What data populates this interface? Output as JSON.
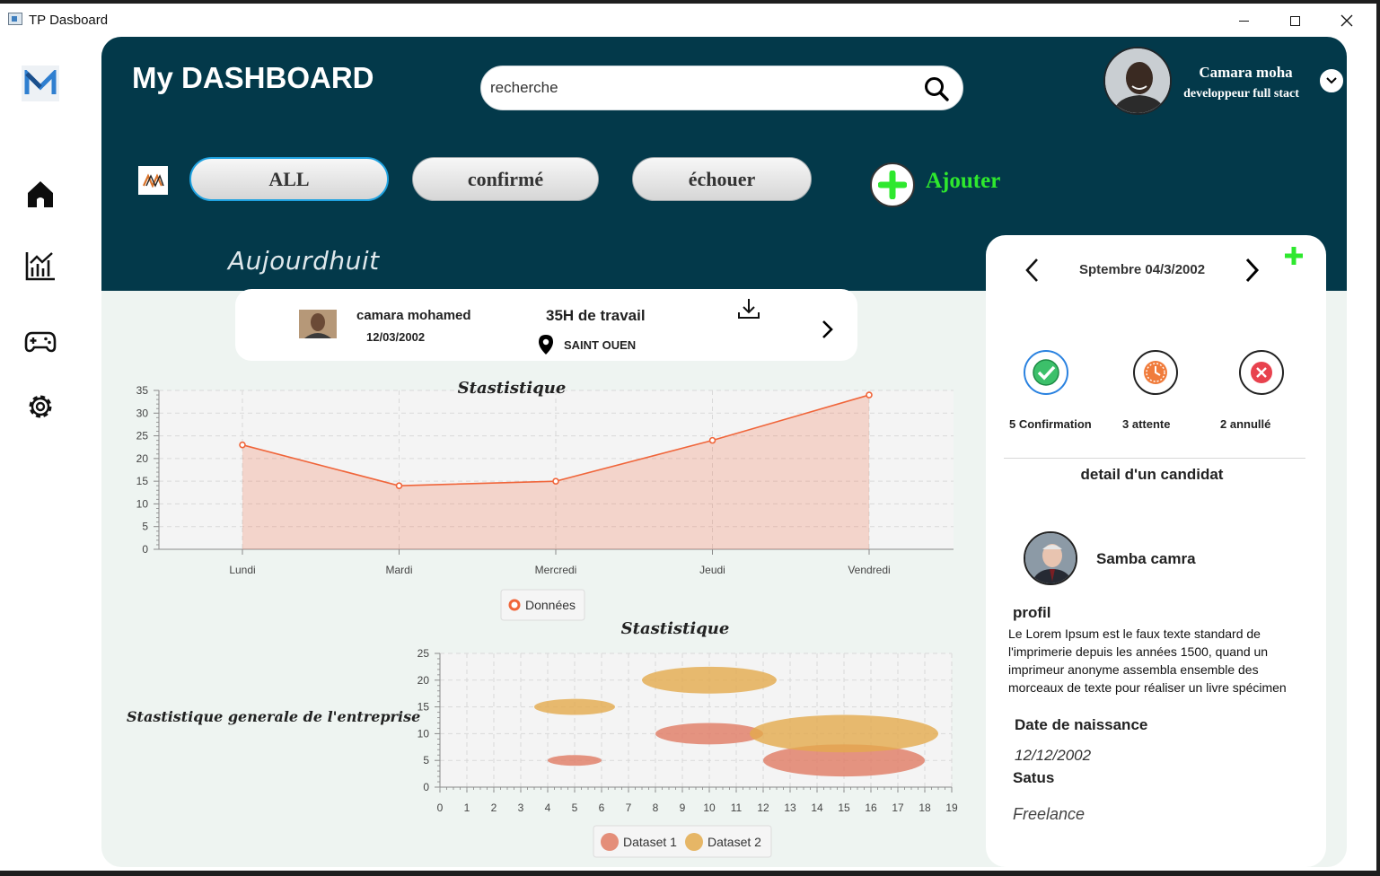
{
  "window": {
    "title": "TP Dasboard"
  },
  "header": {
    "title": "My DASHBOARD",
    "search": {
      "value": "recherche",
      "placeholder": ""
    },
    "user": {
      "name": "Camara moha",
      "role": "developpeur full stact"
    }
  },
  "filters": {
    "all": "ALL",
    "confirmed": "confirmé",
    "failed": "échouer",
    "add": "Ajouter"
  },
  "today_label": "Aujourdhuit",
  "card": {
    "name": "camara mohamed",
    "date": "12/03/2002",
    "hours": "35H de travail",
    "place": "SAINT OUEN"
  },
  "side_panel": {
    "date": "Sptembre 04/3/2002",
    "stats": {
      "confirmed": "5 Confirmation",
      "waiting": "3 attente",
      "cancelled": "2 annullé"
    },
    "detail_title": "detail d'un candidat",
    "candidate": {
      "name": "Samba camra",
      "profil_label": "profil",
      "profil_text": "Le Lorem Ipsum est le faux texte standard de l'imprimerie depuis les années 1500, quand un imprimeur anonyme assembla ensemble des morceaux de texte pour réaliser un livre spécimen",
      "dob_label": "Date de naissance",
      "dob": "12/12/2002",
      "status_label": "Satus",
      "status": "Freelance"
    }
  },
  "side_caption": "Stastistique generale de l'entreprise",
  "colors": {
    "header": "#03394a",
    "accent_green": "#2ee82e",
    "line": "#f0653a",
    "dataset1": "#e07b63",
    "dataset2": "#e3aa4c"
  },
  "chart_data": [
    {
      "type": "area",
      "title": "Stastistique",
      "categories": [
        "Lundi",
        "Mardi",
        "Mercredi",
        "Jeudi",
        "Vendredi"
      ],
      "series": [
        {
          "name": "Données",
          "values": [
            23,
            14,
            15,
            24,
            34
          ]
        }
      ],
      "ylim": [
        0,
        35
      ],
      "yticks": [
        0,
        5,
        10,
        15,
        20,
        25,
        30,
        35
      ],
      "grid": true,
      "legend": "bottom"
    },
    {
      "type": "bubble",
      "title": "Stastistique",
      "xlim": [
        0,
        19
      ],
      "ylim": [
        0,
        25
      ],
      "xticks": [
        0,
        1,
        2,
        3,
        4,
        5,
        6,
        7,
        8,
        9,
        10,
        11,
        12,
        13,
        14,
        15,
        16,
        17,
        18,
        19
      ],
      "yticks": [
        0,
        5,
        10,
        15,
        20,
        25
      ],
      "grid": true,
      "legend": "bottom",
      "series": [
        {
          "name": "Dataset 1",
          "points": [
            {
              "x": 5,
              "y": 5,
              "r": 1
            },
            {
              "x": 10,
              "y": 10,
              "r": 2
            },
            {
              "x": 15,
              "y": 5,
              "r": 3
            }
          ]
        },
        {
          "name": "Dataset 2",
          "points": [
            {
              "x": 5,
              "y": 15,
              "r": 1.5
            },
            {
              "x": 10,
              "y": 20,
              "r": 2.5
            },
            {
              "x": 15,
              "y": 10,
              "r": 3.5
            }
          ]
        }
      ]
    }
  ]
}
